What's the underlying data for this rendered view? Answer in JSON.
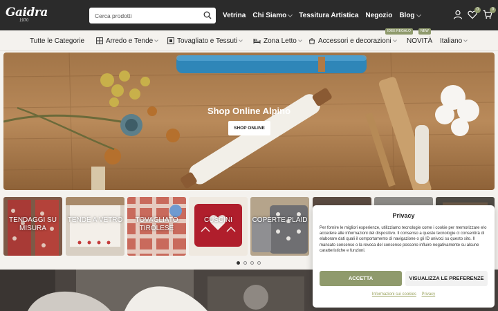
{
  "header": {
    "logo_text": "Gaidra",
    "logo_year": "1970",
    "search_placeholder": "Cerca prodotti",
    "nav": [
      {
        "label": "Vetrina",
        "has_submenu": false
      },
      {
        "label": "Chi Siamo",
        "has_submenu": true
      },
      {
        "label": "Tessitura Artistica",
        "has_submenu": false
      },
      {
        "label": "Negozio",
        "has_submenu": false
      },
      {
        "label": "Blog",
        "has_submenu": true
      }
    ],
    "icons": {
      "account": "user-icon",
      "wishlist": "heart-icon",
      "wishlist_count": "0",
      "cart": "cart-icon",
      "cart_count": "0"
    },
    "accent_color": "#8f9a6c"
  },
  "categories": {
    "items": [
      {
        "label": "Tutte le Categorie",
        "icon": null,
        "has_submenu": false
      },
      {
        "label": "Arredo e Tende",
        "icon": "window-icon",
        "has_submenu": true
      },
      {
        "label": "Tovagliato e Tessuti",
        "icon": "table-cloth-icon",
        "has_submenu": true
      },
      {
        "label": "Zona Letto",
        "icon": "bed-icon",
        "has_submenu": true
      },
      {
        "label": "Accessori e decorazioni",
        "icon": "bag-icon",
        "has_submenu": true
      },
      {
        "label": "NOVITÀ",
        "icon": null,
        "has_submenu": false
      },
      {
        "label": "Italiano",
        "icon": null,
        "has_submenu": true
      }
    ],
    "tags": {
      "gift_idea": "IDEE REGALO",
      "new": "NEW"
    }
  },
  "hero": {
    "title": "Shop Online Alpino",
    "button_label": "SHOP ONLINE"
  },
  "tiles": [
    {
      "label": "TENDAGGI SU MISURA"
    },
    {
      "label": "TENDE A VETRO"
    },
    {
      "label": "TOVAGLIATO TIROLESE"
    },
    {
      "label": "CUSCINI"
    },
    {
      "label": "COPERTE PLAID"
    },
    {
      "label": ""
    },
    {
      "label": ""
    },
    {
      "label": ""
    }
  ],
  "carousel": {
    "pages": 4,
    "active_page": 1
  },
  "privacy": {
    "title": "Privacy",
    "body": "Per fornire le migliori esperienze, utilizziamo tecnologie come i cookie per memorizzare e/o accedere alle informazioni del dispositivo. Il consenso a queste tecnologie ci consentirà di elaborare dati quali il comportamento di navigazione o gli ID univoci su questo sito. Il mancato consenso o la revoca del consenso possono influire negativamente su alcune caratteristiche e funzioni.",
    "accept_label": "ACCETTA",
    "preferences_label": "VISUALIZZA LE PREFERENZE",
    "cookie_link": "Informazioni sui cookies",
    "privacy_link": "Privacy"
  }
}
